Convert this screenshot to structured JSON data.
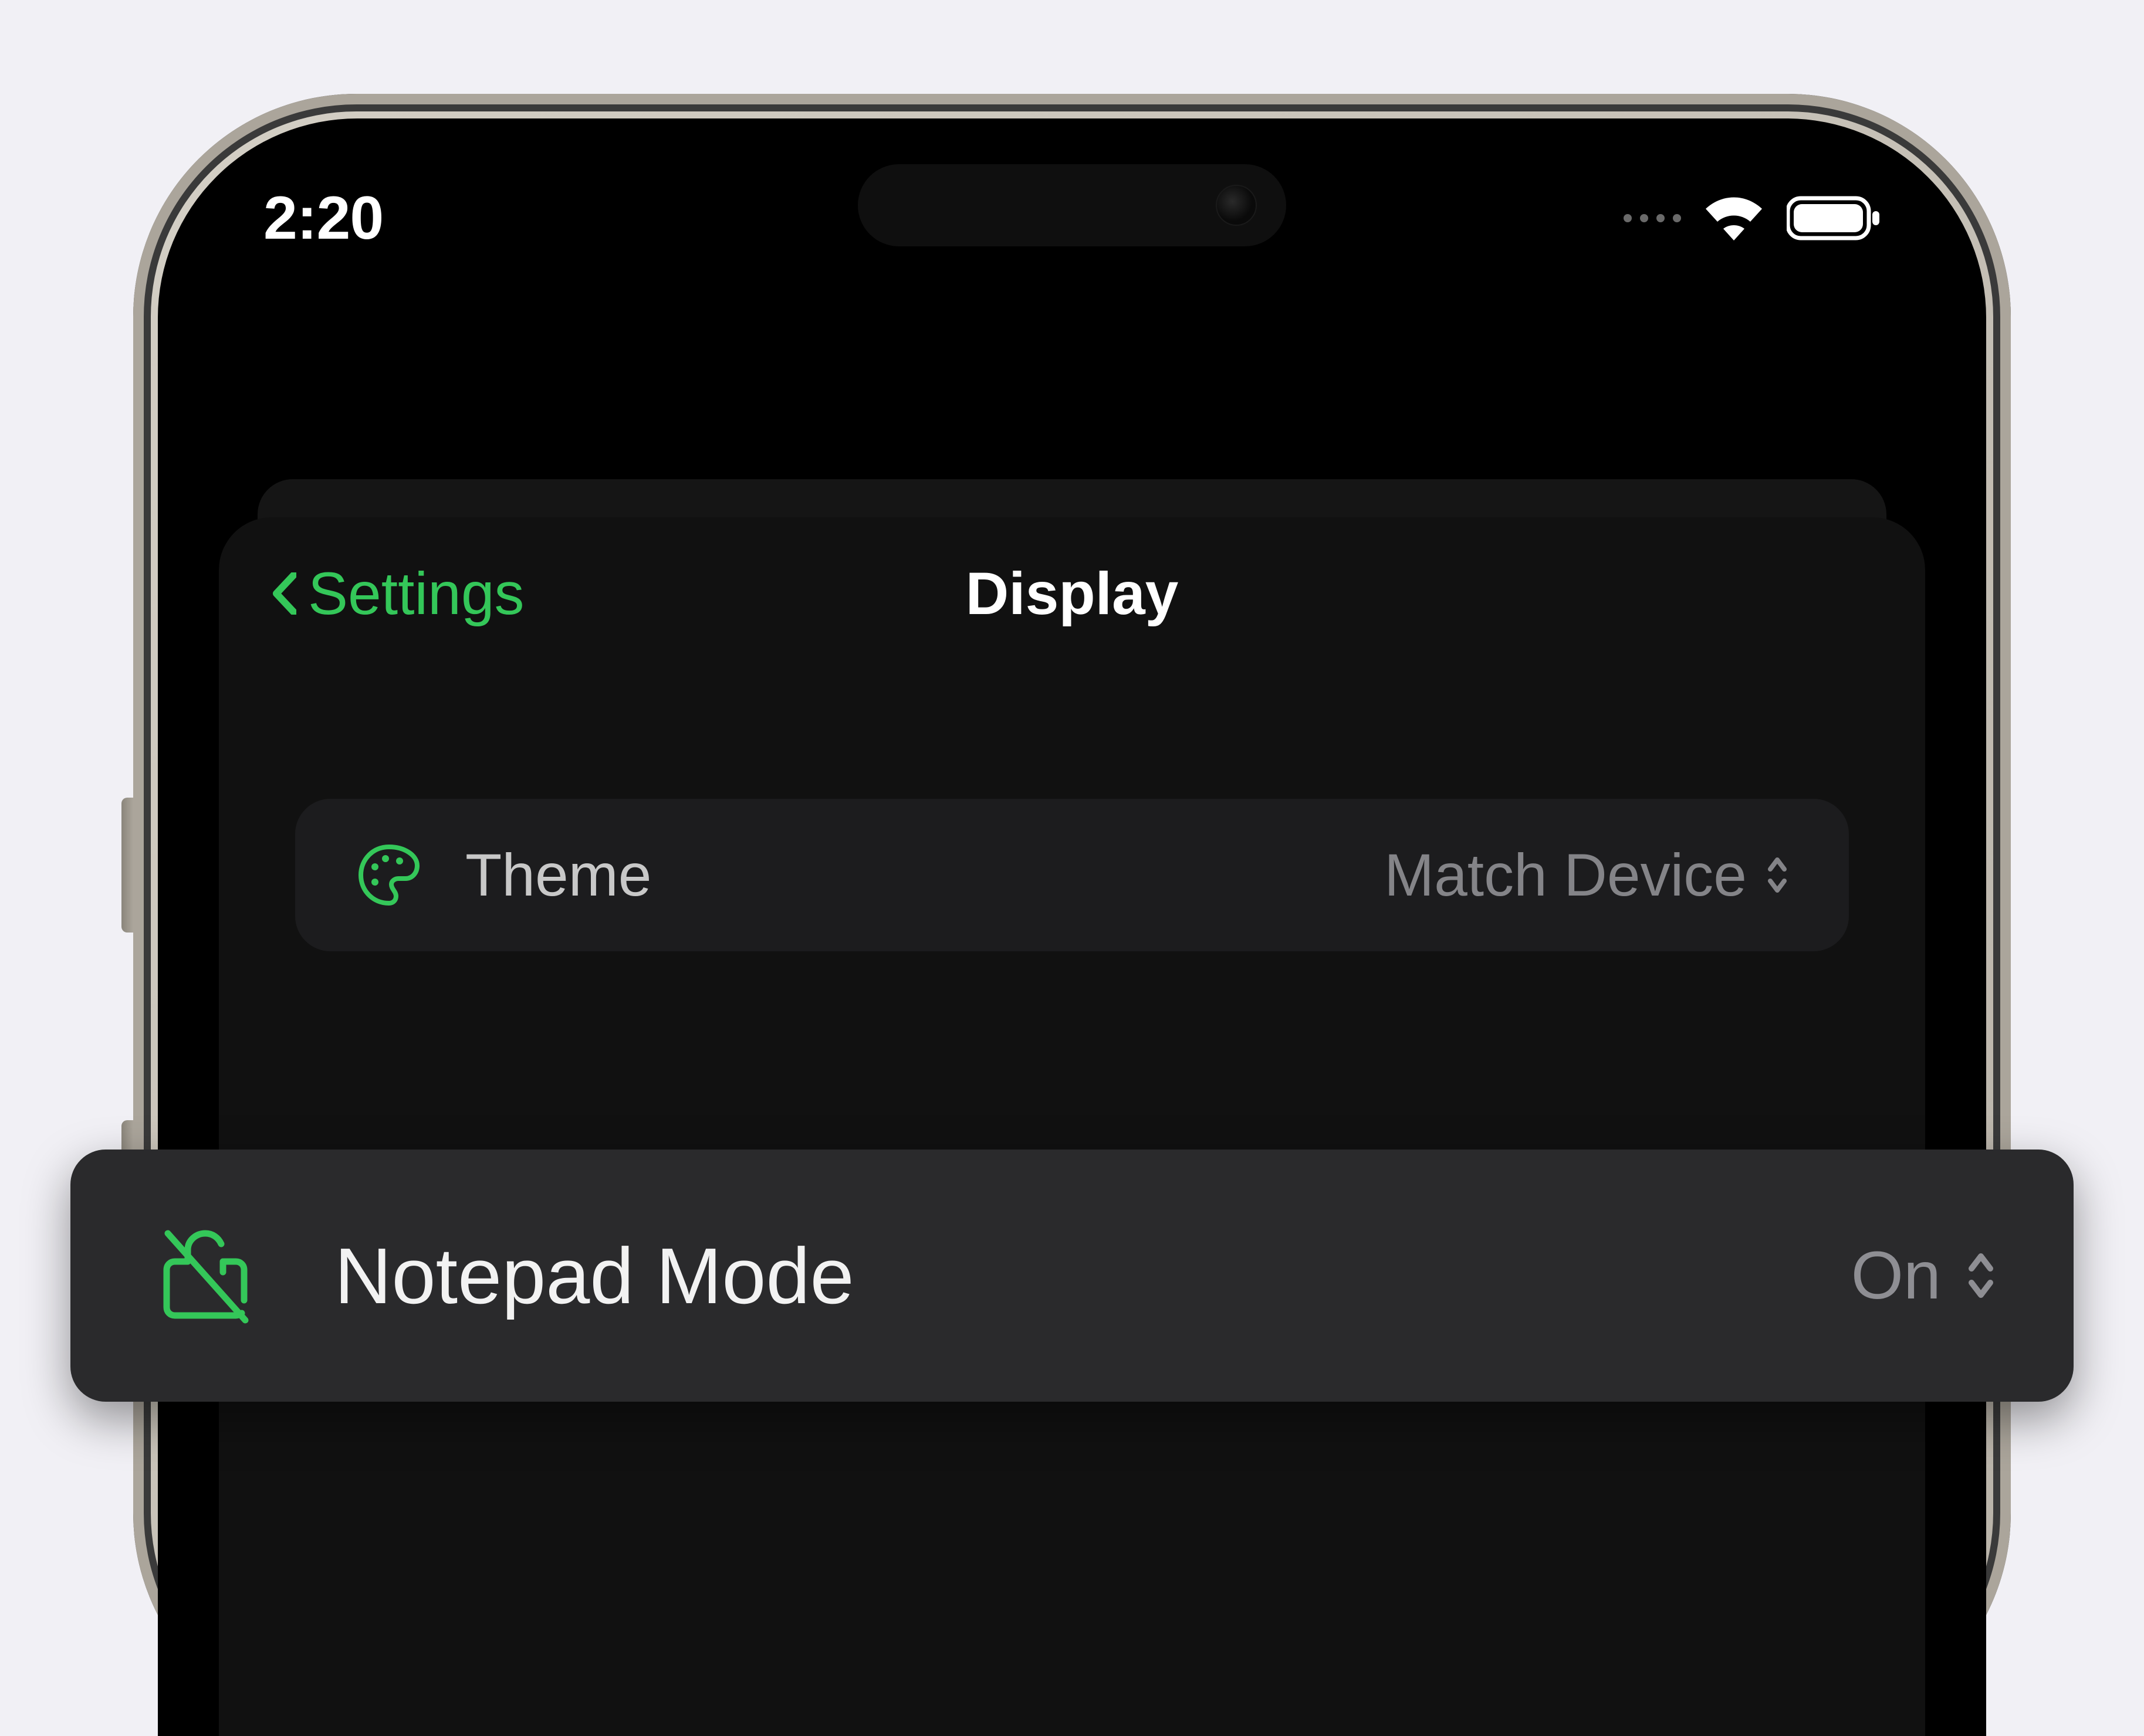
{
  "statusBar": {
    "time": "2:20"
  },
  "nav": {
    "backLabel": "Settings",
    "title": "Display"
  },
  "settings": {
    "theme": {
      "label": "Theme",
      "value": "Match Device"
    }
  },
  "highlighted": {
    "label": "Notepad Mode",
    "value": "On"
  },
  "colors": {
    "accent": "#34c759",
    "background": "#000000",
    "cardBg": "#1c1c1e"
  }
}
